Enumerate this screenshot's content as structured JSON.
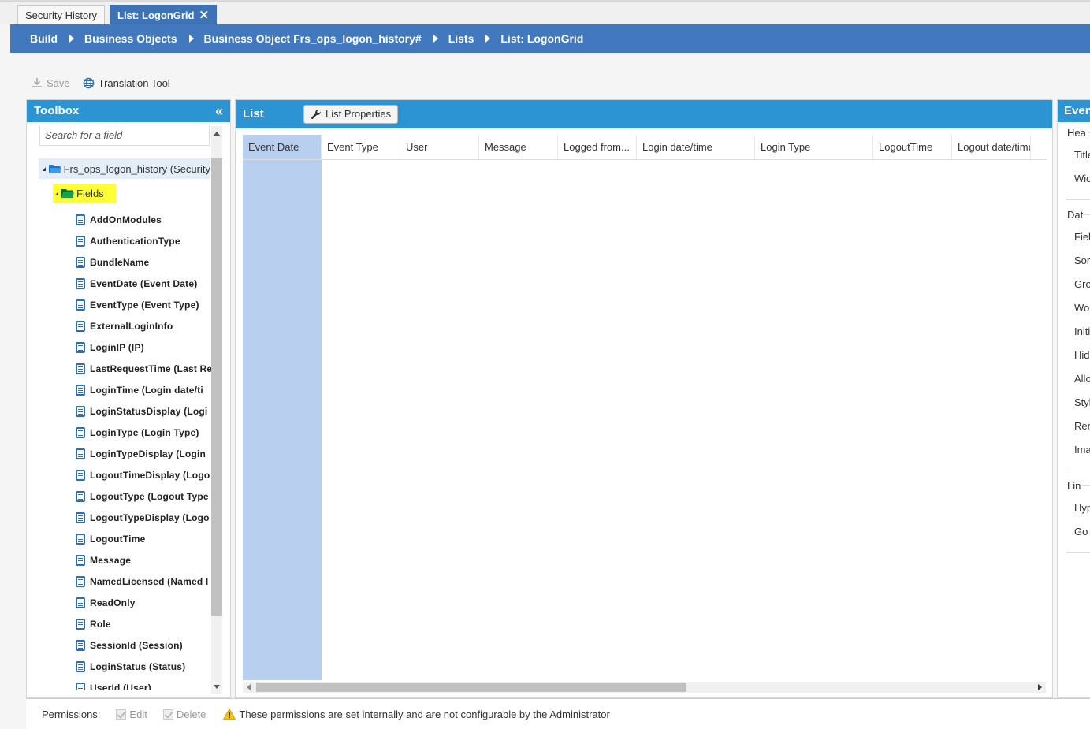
{
  "tabs": [
    {
      "label": "Security History",
      "active": false
    },
    {
      "label": "List: LogonGrid",
      "active": true
    }
  ],
  "breadcrumb": [
    "Build",
    "Business Objects",
    "Business Object Frs_ops_logon_history#",
    "Lists",
    "List: LogonGrid"
  ],
  "toolbar": {
    "save": "Save",
    "translation": "Translation Tool"
  },
  "toolbox": {
    "title": "Toolbox",
    "search_placeholder": "Search for a field",
    "root": "Frs_ops_logon_history (Security",
    "fields_folder": "Fields",
    "fields": [
      "AddOnModules",
      "AuthenticationType",
      "BundleName",
      "EventDate (Event Date)",
      "EventType (Event Type)",
      "ExternalLoginInfo",
      "LoginIP (IP)",
      "LastRequestTime (Last Re",
      "LoginTime (Login date/ti",
      "LoginStatusDisplay (Logi",
      "LoginType (Login Type)",
      "LoginTypeDisplay (Login",
      "LogoutTimeDisplay (Logo",
      "LogoutType (Logout Type",
      "LogoutTypeDisplay (Logo",
      "LogoutTime",
      "Message",
      "NamedLicensed (Named I",
      "ReadOnly",
      "Role",
      "SessionId (Session)",
      "LoginStatus (Status)",
      "UserId (User)"
    ]
  },
  "list": {
    "title": "List",
    "properties_button": "List Properties",
    "columns": [
      "Event Date",
      "Event Type",
      "User",
      "Message",
      "Logged from...",
      "Login date/time",
      "Login Type",
      "LogoutTime",
      "Logout date/time"
    ]
  },
  "events": {
    "title": "Even",
    "groups": [
      {
        "title": "Hea",
        "rows": [
          "Title",
          "Wid"
        ]
      },
      {
        "title": "Dat",
        "rows": [
          "Fiel",
          "Sor",
          "Gro",
          "Wor",
          "Initi",
          "Hid",
          "Allo",
          "Styl",
          "Ren",
          "Ima"
        ]
      },
      {
        "title": "Lin",
        "rows": [
          "Hyp",
          "Go"
        ]
      }
    ]
  },
  "footer": {
    "permissions_label": "Permissions:",
    "edit": "Edit",
    "delete": "Delete",
    "warning": "These permissions are set internally and are not configurable by the Administrator"
  },
  "colors": {
    "accent": "#2d94d4",
    "breadcrumb_bg": "#4178be",
    "selection": "#b8cff0",
    "highlight": "#ffff33"
  }
}
